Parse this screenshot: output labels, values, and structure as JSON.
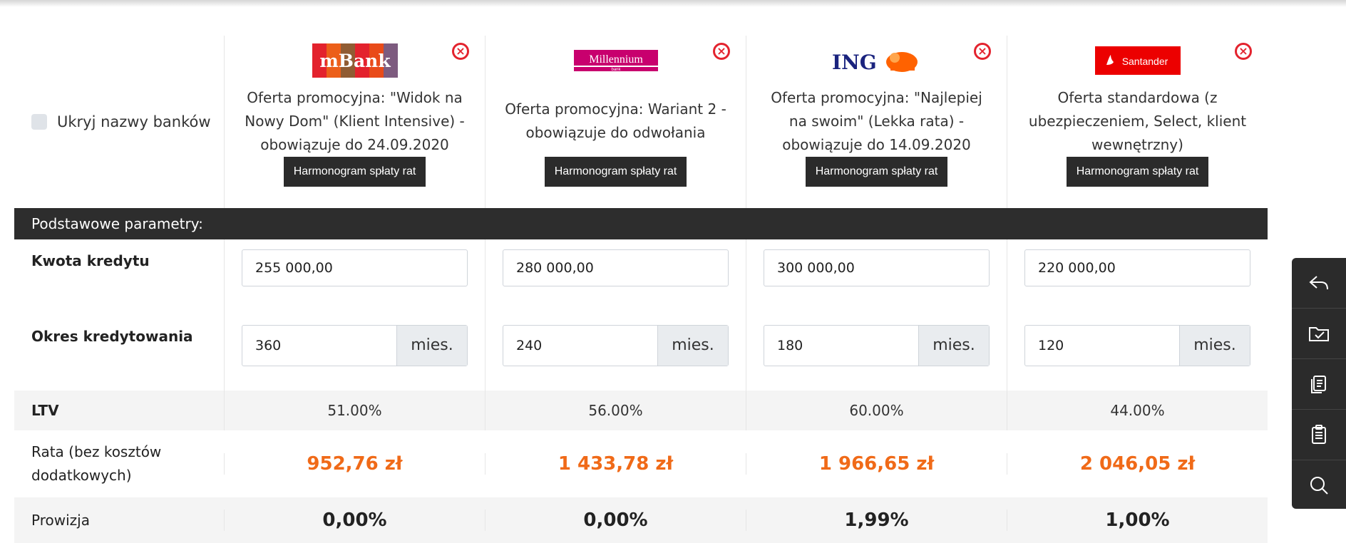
{
  "hide_names_label": "Ukryj nazwy banków",
  "section_title": "Podstawowe parametry:",
  "schedule_label": "Harmonogram spłaty rat",
  "unit_months": "mies.",
  "rows": {
    "amount": "Kwota kredytu",
    "period": "Okres kredytowania",
    "ltv": "LTV",
    "rate": "Rata (bez kosztów dodatkowych)",
    "commission": "Prowizja"
  },
  "banks": [
    {
      "logo": "mBank",
      "offer": "Oferta promocyjna: \"Widok na Nowy Dom\" (Klient Intensive) - obowiązuje do 24.09.2020",
      "amount": "255 000,00",
      "period": "360",
      "ltv": "51.00%",
      "rate": "952,76 zł",
      "commission": "0,00%"
    },
    {
      "logo": "Millennium",
      "logo_sub": "bank",
      "offer": "Oferta promocyjna: Wariant 2 - obowiązuje do odwołania",
      "amount": "280 000,00",
      "period": "240",
      "ltv": "56.00%",
      "rate": "1 433,78 zł",
      "commission": "0,00%"
    },
    {
      "logo": "ING",
      "offer": "Oferta promocyjna: \"Najlepiej na swoim\" (Lekka rata) - obowiązuje do 14.09.2020",
      "amount": "300 000,00",
      "period": "180",
      "ltv": "60.00%",
      "rate": "1 966,65 zł",
      "commission": "1,99%"
    },
    {
      "logo": "Santander",
      "offer": "Oferta standardowa (z ubezpieczeniem, Select, klient wewnętrzny)",
      "amount": "220 000,00",
      "period": "120",
      "ltv": "44.00%",
      "rate": "2 046,05 zł",
      "commission": "1,00%"
    }
  ],
  "colors": {
    "accent_orange": "#f06a18",
    "remove_red": "#e3232e",
    "dark_bar": "#2d2d2d"
  },
  "toolbar_icons": [
    "reply-icon",
    "folder-check-icon",
    "copy-icon",
    "clipboard-icon",
    "search-icon"
  ]
}
